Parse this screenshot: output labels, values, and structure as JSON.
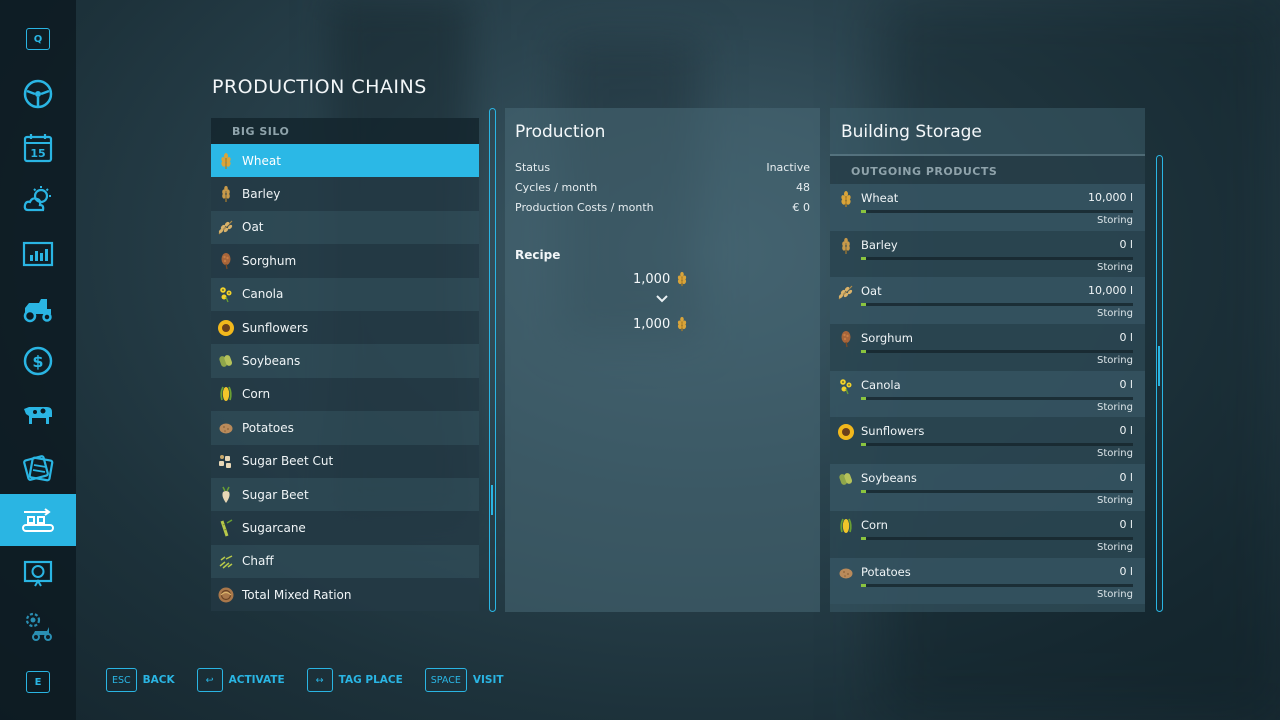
{
  "colors": {
    "accent": "#2ab5e3",
    "fill_bar": "#8ac43f"
  },
  "sidebar": {
    "top_key": "Q",
    "bottom_key": "E",
    "items": [
      {
        "icon": "steering-wheel-icon"
      },
      {
        "icon": "calendar-icon",
        "label": "15"
      },
      {
        "icon": "weather-icon"
      },
      {
        "icon": "statistics-icon"
      },
      {
        "icon": "tractor-icon"
      },
      {
        "icon": "finances-icon"
      },
      {
        "icon": "animals-icon"
      },
      {
        "icon": "contracts-icon"
      },
      {
        "icon": "production-icon",
        "active": true
      },
      {
        "icon": "help-icon"
      },
      {
        "icon": "settings-icon"
      }
    ]
  },
  "page": {
    "title": "PRODUCTION CHAINS"
  },
  "chains": {
    "group": "BIG SILO",
    "items": [
      {
        "label": "Wheat",
        "icon": "wheat-icon",
        "selected": true
      },
      {
        "label": "Barley",
        "icon": "barley-icon"
      },
      {
        "label": "Oat",
        "icon": "oat-icon"
      },
      {
        "label": "Sorghum",
        "icon": "sorghum-icon"
      },
      {
        "label": "Canola",
        "icon": "canola-icon"
      },
      {
        "label": "Sunflowers",
        "icon": "sunflower-icon"
      },
      {
        "label": "Soybeans",
        "icon": "soybeans-icon"
      },
      {
        "label": "Corn",
        "icon": "corn-icon"
      },
      {
        "label": "Potatoes",
        "icon": "potato-icon"
      },
      {
        "label": "Sugar Beet Cut",
        "icon": "sugar-beet-cut-icon"
      },
      {
        "label": "Sugar Beet",
        "icon": "sugar-beet-icon"
      },
      {
        "label": "Sugarcane",
        "icon": "sugarcane-icon"
      },
      {
        "label": "Chaff",
        "icon": "chaff-icon"
      },
      {
        "label": "Total Mixed Ration",
        "icon": "tmr-icon"
      }
    ]
  },
  "production": {
    "title": "Production",
    "status_label": "Status",
    "status_value": "Inactive",
    "cycles_label": "Cycles / month",
    "cycles_value": "48",
    "costs_label": "Production Costs / month",
    "costs_value": "€ 0",
    "recipe_label": "Recipe",
    "input_amount": "1,000",
    "output_amount": "1,000"
  },
  "storage": {
    "title": "Building Storage",
    "section": "OUTGOING PRODUCTS",
    "rows": [
      {
        "name": "Wheat",
        "amount": "10,000 l",
        "status": "Storing",
        "icon": "wheat-icon"
      },
      {
        "name": "Barley",
        "amount": "0 l",
        "status": "Storing",
        "icon": "barley-icon"
      },
      {
        "name": "Oat",
        "amount": "10,000 l",
        "status": "Storing",
        "icon": "oat-icon"
      },
      {
        "name": "Sorghum",
        "amount": "0 l",
        "status": "Storing",
        "icon": "sorghum-icon"
      },
      {
        "name": "Canola",
        "amount": "0 l",
        "status": "Storing",
        "icon": "canola-icon"
      },
      {
        "name": "Sunflowers",
        "amount": "0 l",
        "status": "Storing",
        "icon": "sunflower-icon"
      },
      {
        "name": "Soybeans",
        "amount": "0 l",
        "status": "Storing",
        "icon": "soybeans-icon"
      },
      {
        "name": "Corn",
        "amount": "0 l",
        "status": "Storing",
        "icon": "corn-icon"
      },
      {
        "name": "Potatoes",
        "amount": "0 l",
        "status": "Storing",
        "icon": "potato-icon"
      }
    ]
  },
  "actions": [
    {
      "key": "ESC",
      "label": "BACK"
    },
    {
      "key": "↩",
      "label": "ACTIVATE"
    },
    {
      "key": "↔",
      "label": "TAG PLACE"
    },
    {
      "key": "SPACE",
      "label": "VISIT"
    }
  ]
}
